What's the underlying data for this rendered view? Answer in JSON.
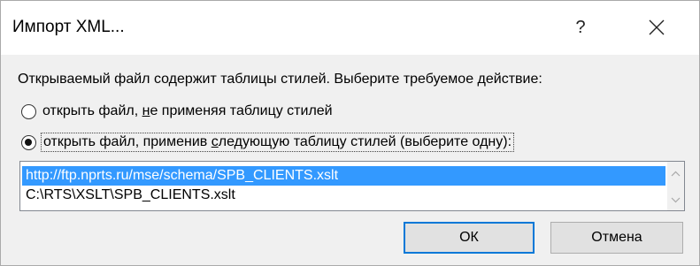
{
  "window": {
    "title": "Импорт XML...",
    "help_label": "?",
    "close_icon": "close-icon"
  },
  "prompt": "Открываемый файл содержит таблицы стилей.  Выберите требуемое действие:",
  "options": [
    {
      "selected": false,
      "label_before": "открыть файл, ",
      "label_accel": "н",
      "label_after": "е применяя таблицу стилей"
    },
    {
      "selected": true,
      "label_before": "открыть файл, применив ",
      "label_accel": "с",
      "label_after": "ледующую таблицу стилей (выберите одну):"
    }
  ],
  "stylesheets": {
    "items": [
      "http://ftp.nprts.ru/mse/schema/SPB_CLIENTS.xslt",
      "C:\\RTS\\XSLT\\SPB_CLIENTS.xslt"
    ],
    "selected_index": 0
  },
  "buttons": {
    "ok": "ОК",
    "cancel": "Отмена"
  },
  "colors": {
    "selection": "#3399ff",
    "default_button_border": "#0078d7",
    "background": "#f0f0f0"
  }
}
